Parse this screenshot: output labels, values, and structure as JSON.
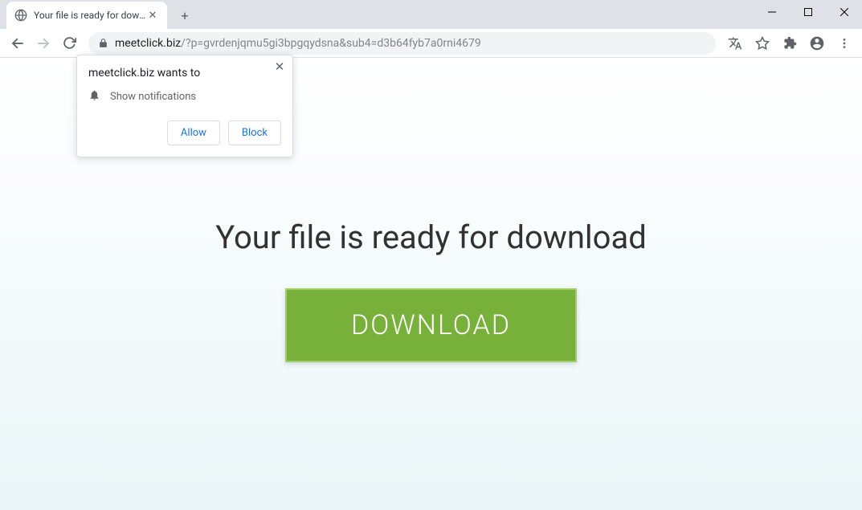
{
  "tab": {
    "title": "Your file is ready for download"
  },
  "url": {
    "host": "meetclick.biz",
    "path": "/?p=gvrdenjqmu5gi3bpgqydsna&sub4=d3b64fyb7a0rni4679"
  },
  "page": {
    "heading": "Your file is ready for download",
    "download_label": "DOWNLOAD"
  },
  "prompt": {
    "title": "meetclick.biz wants to",
    "permission": "Show notifications",
    "allow": "Allow",
    "block": "Block"
  }
}
